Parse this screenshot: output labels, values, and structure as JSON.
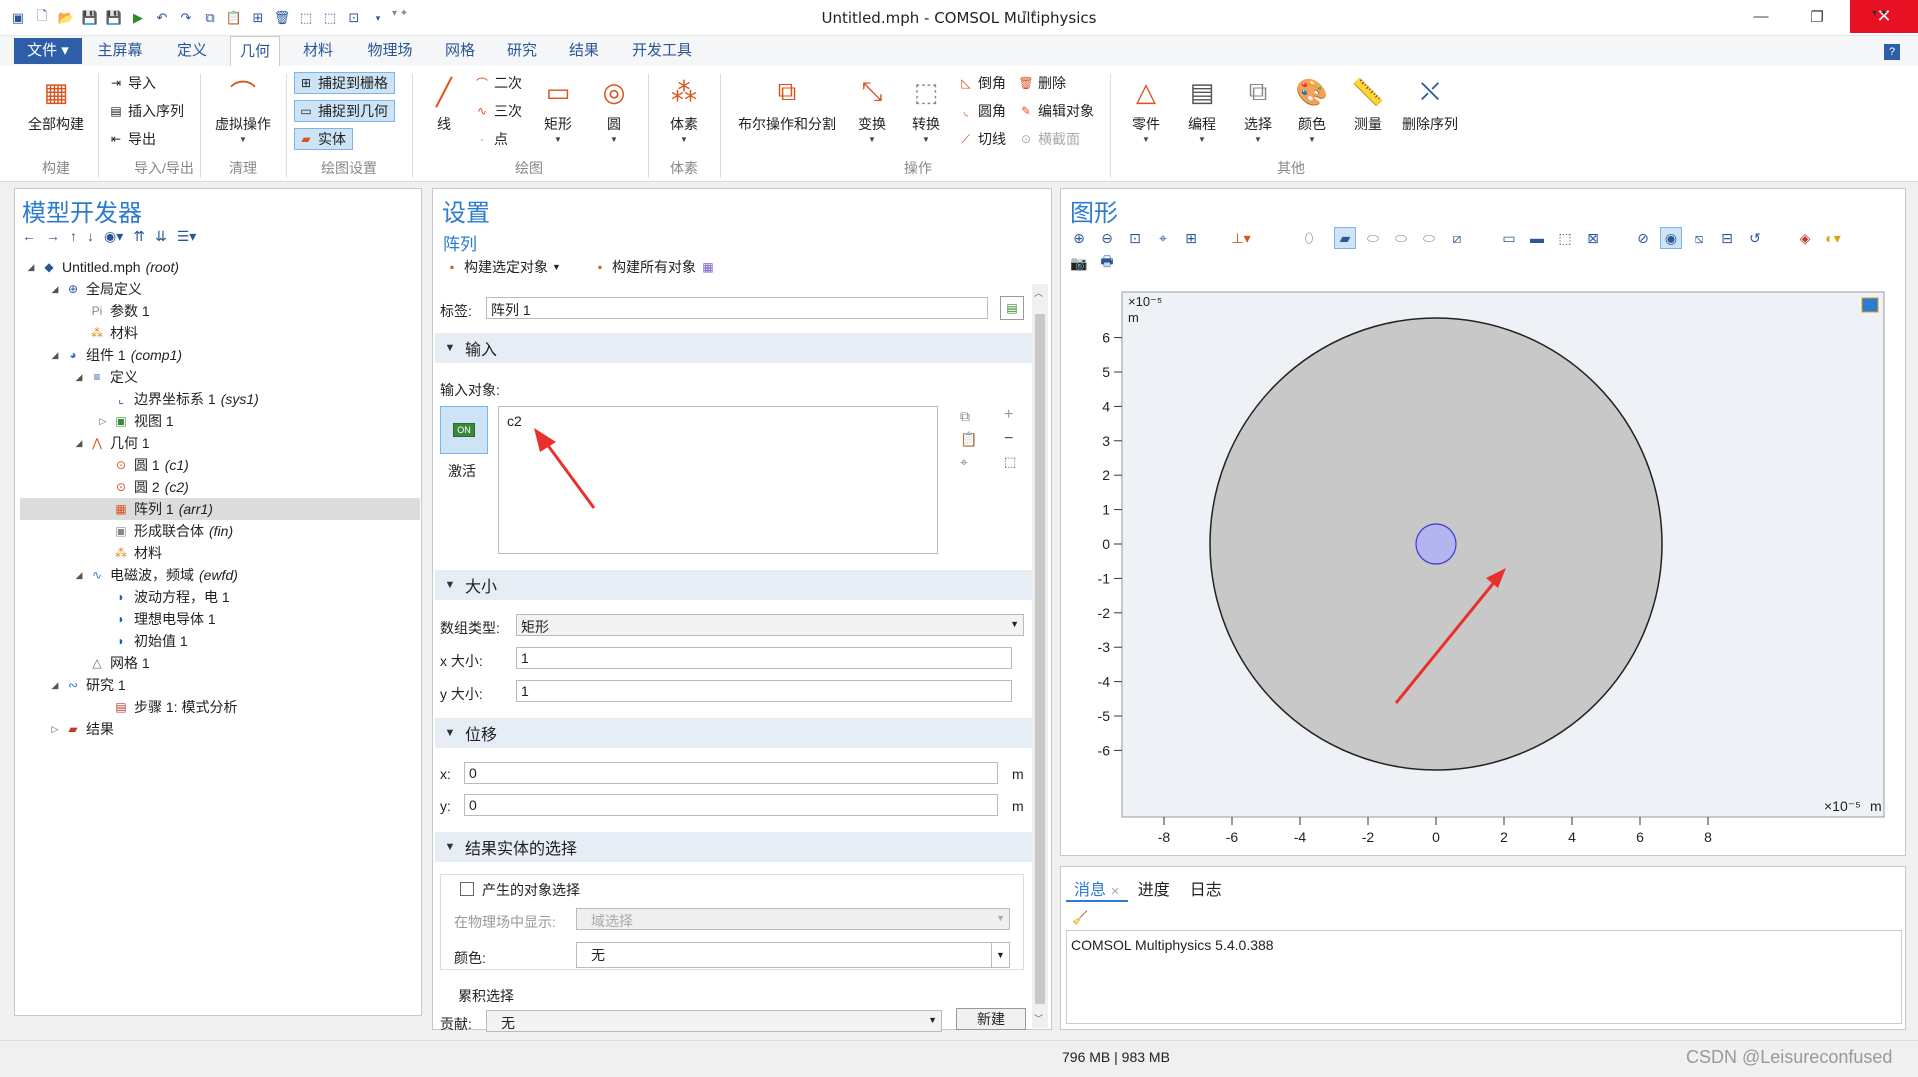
{
  "window": {
    "title": "Untitled.mph - COMSOL Multiphysics",
    "minimize_glyph": "—",
    "restore_glyph": "❐",
    "close_glyph": "✕"
  },
  "menu": {
    "file_label": "文件 ▾",
    "tabs": [
      "主屏幕",
      "定义",
      "几何",
      "材料",
      "物理场",
      "网格",
      "研究",
      "结果",
      "开发工具"
    ],
    "active_tab": "几何",
    "help_glyph": "?"
  },
  "ribbon": {
    "build_all": "全部构建",
    "import": "导入",
    "insert_sequence": "插入序列",
    "export": "导出",
    "virtual_ops": "虚拟操作",
    "snap_grid": "捕捉到栅格",
    "snap_geometry": "捕捉到几何",
    "solid": "实体",
    "line": "线",
    "quadratic": "二次",
    "cubic": "三次",
    "point": "点",
    "rectangle": "矩形",
    "circle": "圆",
    "voxels": "体素",
    "boolean": "布尔操作和分割",
    "transforms": "变换",
    "conversions": "转换",
    "chamfer": "倒角",
    "fillet": "圆角",
    "tangent": "切线",
    "delete": "删除",
    "edit_object": "编辑对象",
    "cross_section": "横截面",
    "parts": "零件",
    "programming": "编程",
    "selections": "选择",
    "colors": "颜色",
    "measure": "测量",
    "delete_sequence": "删除序列",
    "groups": {
      "build": "构建",
      "import_export": "导入/导出",
      "cleanup": "清理",
      "draw_settings": "绘图设置",
      "draw": "绘图",
      "voxels": "体素",
      "operations": "操作",
      "other": "其他"
    }
  },
  "model_builder": {
    "title": "模型开发器",
    "tree": [
      {
        "label": "Untitled.mph",
        "tag": "(root)"
      },
      {
        "label": "全局定义",
        "tag": ""
      },
      {
        "label": "参数 1",
        "tag": ""
      },
      {
        "label": "材料",
        "tag": ""
      },
      {
        "label": "组件 1",
        "tag": "(comp1)"
      },
      {
        "label": "定义",
        "tag": ""
      },
      {
        "label": "边界坐标系 1",
        "tag": "(sys1)"
      },
      {
        "label": "视图 1",
        "tag": ""
      },
      {
        "label": "几何 1",
        "tag": ""
      },
      {
        "label": "圆 1",
        "tag": "(c1)"
      },
      {
        "label": "圆 2",
        "tag": "(c2)"
      },
      {
        "label": "阵列 1",
        "tag": "(arr1)"
      },
      {
        "label": "形成联合体",
        "tag": "(fin)"
      },
      {
        "label": "材料",
        "tag": ""
      },
      {
        "label": "电磁波，频域",
        "tag": "(ewfd)"
      },
      {
        "label": "波动方程，电 1",
        "tag": ""
      },
      {
        "label": "理想电导体 1",
        "tag": ""
      },
      {
        "label": "初始值 1",
        "tag": ""
      },
      {
        "label": "网格 1",
        "tag": ""
      },
      {
        "label": "研究 1",
        "tag": ""
      },
      {
        "label": "步骤 1: 模式分析",
        "tag": ""
      },
      {
        "label": "结果",
        "tag": ""
      }
    ]
  },
  "settings": {
    "title": "设置",
    "subtitle": "阵列",
    "build_selected": "构建选定对象",
    "build_all": "构建所有对象",
    "label_caption": "标签:",
    "label_value": "阵列 1",
    "sec_input": "输入",
    "input_objects_caption": "输入对象:",
    "input_objects_value": "c2",
    "activate": "激活",
    "toggle_on": "ON",
    "sec_size": "大小",
    "array_type_caption": "数组类型:",
    "array_type_value": "矩形",
    "x_size_caption": "x 大小:",
    "x_size_value": "1",
    "y_size_caption": "y 大小:",
    "y_size_value": "1",
    "sec_displacement": "位移",
    "x_caption": "x:",
    "x_value": "0",
    "y_caption": "y:",
    "y_value": "0",
    "unit": "m",
    "sec_result_selection": "结果实体的选择",
    "resulting_selection": "产生的对象选择",
    "show_in_physics_caption": "在物理场中显示:",
    "show_in_physics_value": "域选择",
    "color_caption": "颜色:",
    "color_value": "无",
    "cumulative_selection": "累积选择",
    "contribute_caption": "贡献:",
    "contribute_value": "无",
    "new_button": "新建"
  },
  "graphics": {
    "title": "图形",
    "y_exponent": "×10⁻⁵",
    "y_unit": "m",
    "x_exponent": "×10⁻⁵",
    "x_unit": "m",
    "y_ticks": [
      "6",
      "5",
      "4",
      "3",
      "2",
      "1",
      "0",
      "-1",
      "-2",
      "-3",
      "-4",
      "-5",
      "-6"
    ],
    "x_ticks": [
      "-8",
      "-6",
      "-4",
      "-2",
      "0",
      "2",
      "4",
      "6",
      "8"
    ],
    "outer_circle_fill": "#c8c8c8",
    "inner_circle_fill": "#b4b4f0",
    "arrow_color": "#e8312e"
  },
  "messages": {
    "tabs": [
      "消息",
      "进度",
      "日志"
    ],
    "text": "COMSOL Multiphysics 5.4.0.388"
  },
  "status": {
    "memory": "796 MB | 983 MB",
    "watermark": "CSDN @Leisureconfused"
  }
}
